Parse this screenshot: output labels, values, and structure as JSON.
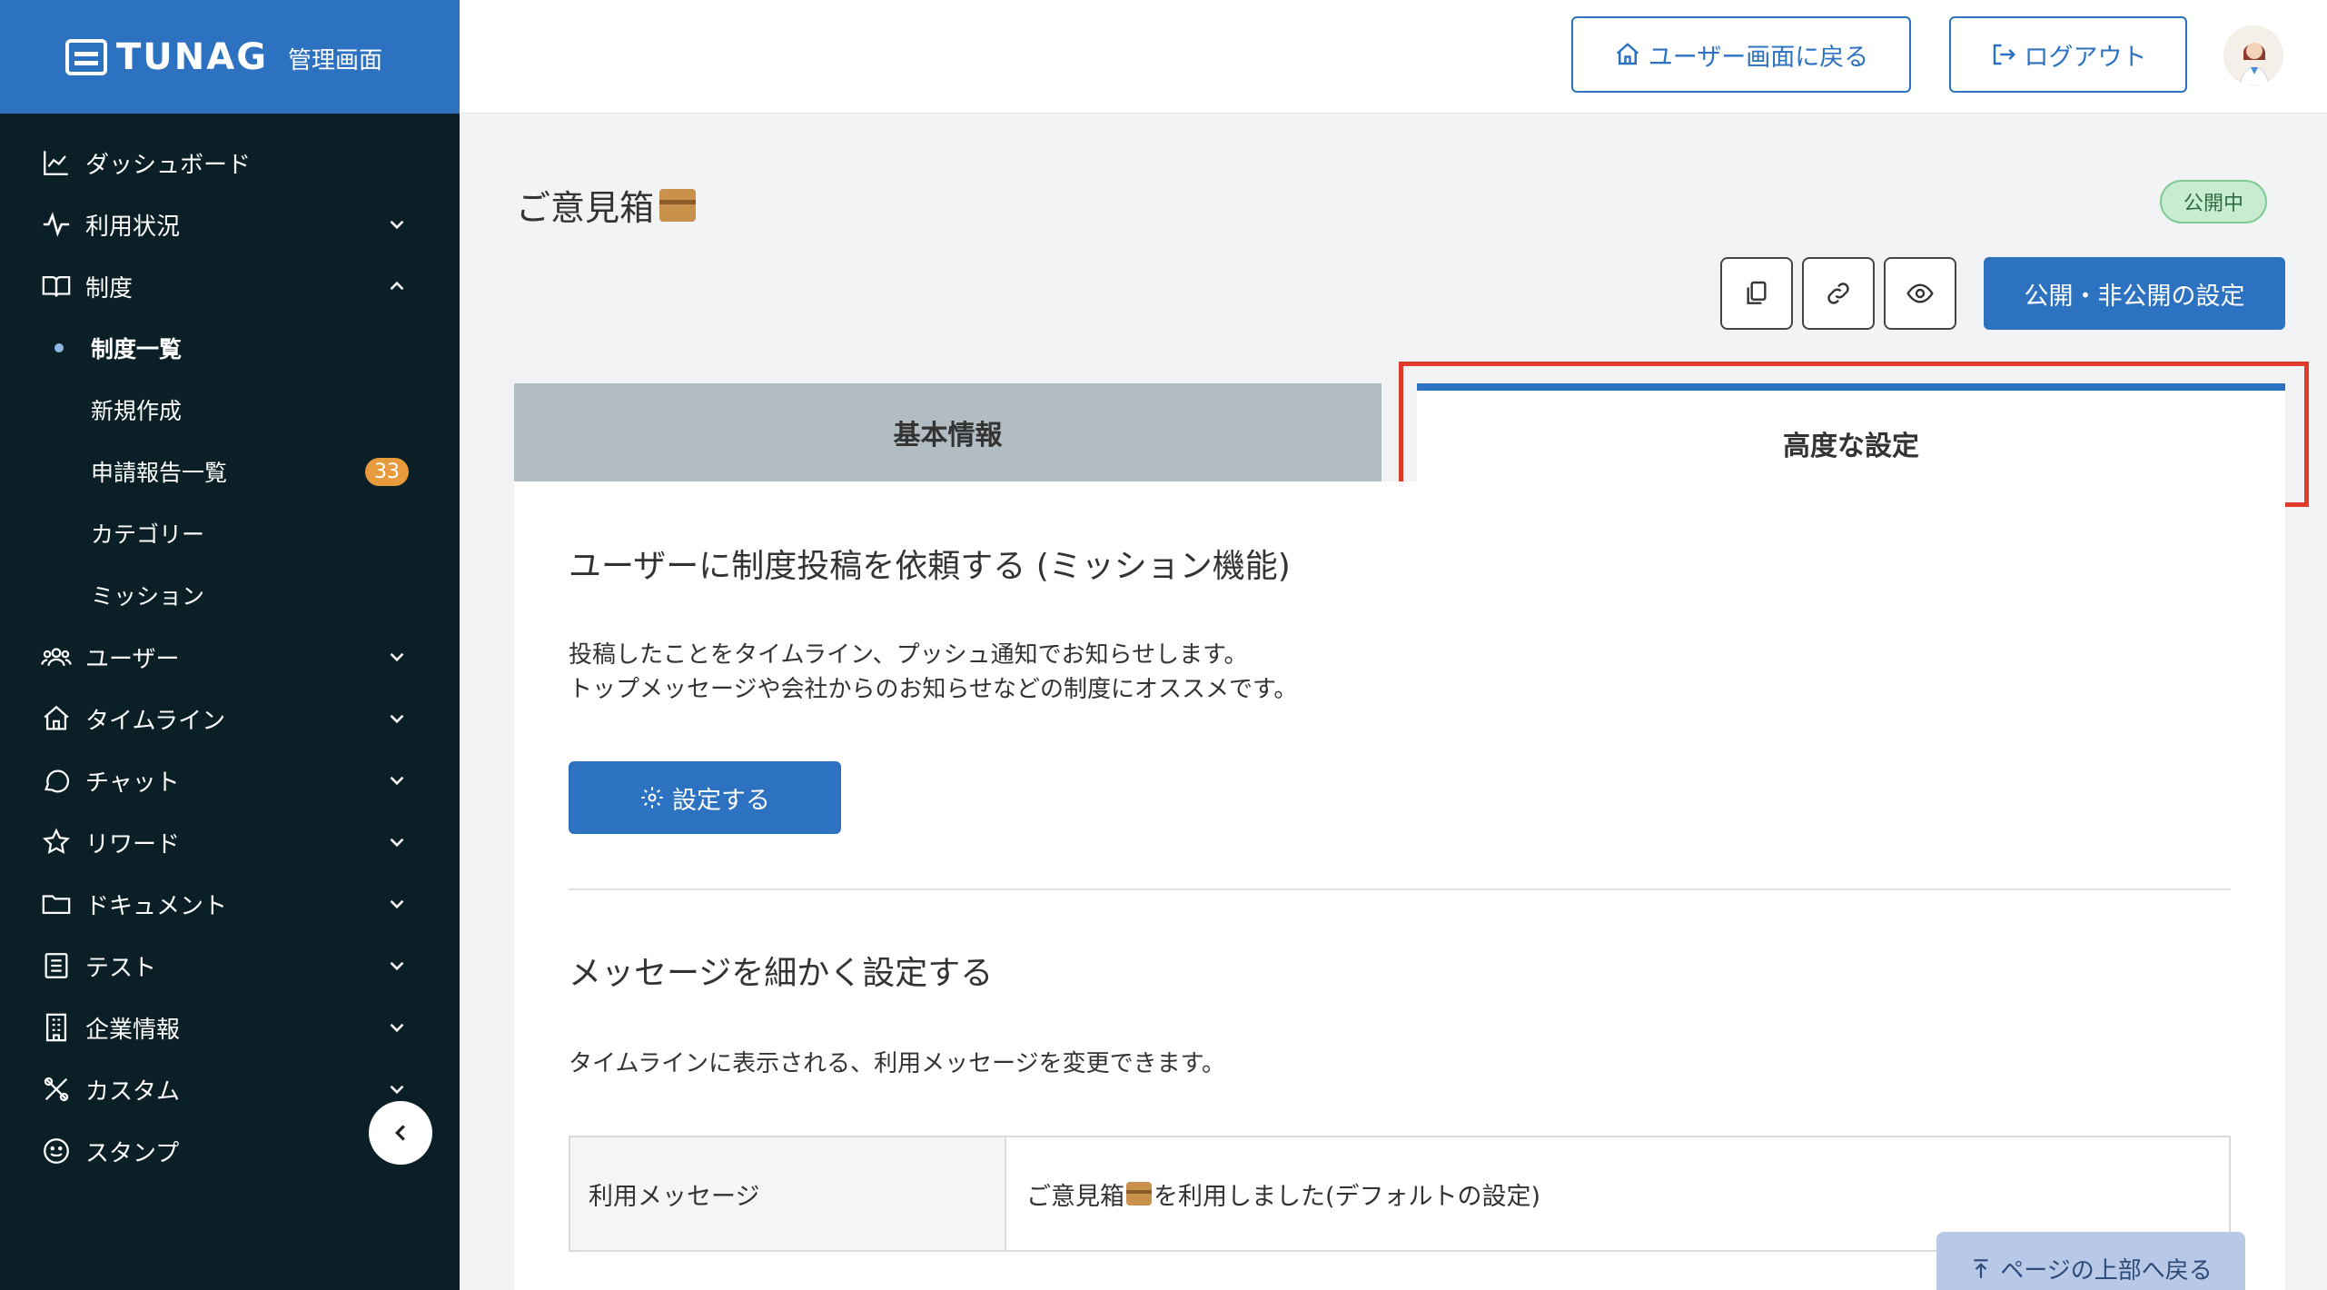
{
  "brand": {
    "name": "TUNAG",
    "sub": "管理画面"
  },
  "sidebar": {
    "items": [
      {
        "label": "ダッシュボード",
        "icon": "chart-line-icon"
      },
      {
        "label": "利用状況",
        "icon": "activity-icon"
      },
      {
        "label": "制度",
        "icon": "book-open-icon"
      },
      {
        "label": "ユーザー",
        "icon": "users-icon"
      },
      {
        "label": "タイムライン",
        "icon": "home-icon"
      },
      {
        "label": "チャット",
        "icon": "chat-icon"
      },
      {
        "label": "リワード",
        "icon": "star-icon"
      },
      {
        "label": "ドキュメント",
        "icon": "folder-icon"
      },
      {
        "label": "テスト",
        "icon": "checklist-icon"
      },
      {
        "label": "企業情報",
        "icon": "building-icon"
      },
      {
        "label": "カスタム",
        "icon": "tools-icon"
      },
      {
        "label": "スタンプ",
        "icon": "smile-icon"
      }
    ],
    "sub_items": [
      {
        "label": "制度一覧"
      },
      {
        "label": "新規作成"
      },
      {
        "label": "申請報告一覧",
        "badge": "33"
      },
      {
        "label": "カテゴリー"
      },
      {
        "label": "ミッション"
      }
    ]
  },
  "header": {
    "user_screen_label": "ユーザー画面に戻る",
    "logout_label": "ログアウト"
  },
  "page": {
    "title": "ご意見箱",
    "status": "公開中",
    "publish_label": "公開・非公開の設定"
  },
  "tabs": [
    {
      "label": "基本情報",
      "active": false
    },
    {
      "label": "高度な設定",
      "active": true
    }
  ],
  "mission": {
    "title": "ユーザーに制度投稿を依頼する (ミッション機能)",
    "desc_line1": "投稿したことをタイムライン、プッシュ通知でお知らせします。",
    "desc_line2": "トップメッセージや会社からのお知らせなどの制度にオススメです。",
    "button_label": "設定する"
  },
  "message": {
    "title": "メッセージを細かく設定する",
    "desc": "タイムラインに表示される、利用メッセージを変更できます。",
    "row_label": "利用メッセージ",
    "row_value_prefix": "ご意見箱",
    "row_value_suffix": "を利用しました(デフォルトの設定)"
  },
  "to_top_label": "ページの上部へ戻る",
  "colors": {
    "brand": "#2c72c1",
    "sidebar": "#0b1f26",
    "highlight": "#e03a2a"
  }
}
